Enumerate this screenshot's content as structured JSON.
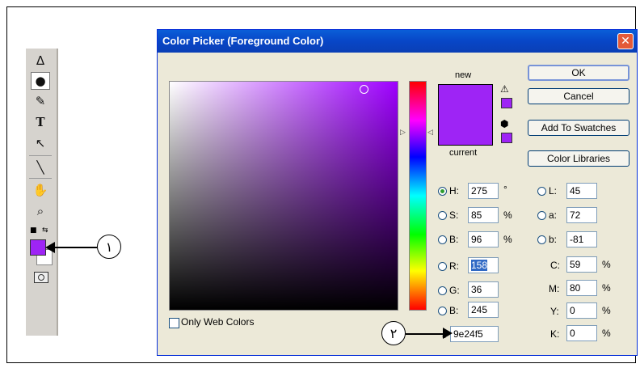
{
  "toolbox": {
    "tools": [
      {
        "icon": "Δ"
      },
      {
        "icon": "●"
      },
      {
        "icon": "✎"
      },
      {
        "icon": "T"
      },
      {
        "icon": "↖"
      },
      {
        "icon": "╲"
      },
      {
        "icon": "✋"
      },
      {
        "icon": "⌕"
      }
    ],
    "foreground_color": "#9e24f5",
    "background_color": "#ffffff"
  },
  "annotations": {
    "label1": "١",
    "label2": "٢"
  },
  "dialog": {
    "title": "Color Picker (Foreground Color)",
    "close": "✕",
    "new_label": "new",
    "current_label": "current",
    "color": "#9e24f5",
    "buttons": {
      "ok": "OK",
      "cancel": "Cancel",
      "add_to_swatches": "Add To Swatches",
      "color_libraries": "Color Libraries"
    },
    "hsb": [
      {
        "label": "H:",
        "value": "275",
        "unit": "°",
        "selected": true
      },
      {
        "label": "S:",
        "value": "85",
        "unit": "%"
      },
      {
        "label": "B:",
        "value": "96",
        "unit": "%"
      }
    ],
    "rgb": [
      {
        "label": "R:",
        "value": "158"
      },
      {
        "label": "G:",
        "value": "36"
      },
      {
        "label": "B:",
        "value": "245"
      }
    ],
    "lab": [
      {
        "label": "L:",
        "value": "45"
      },
      {
        "label": "a:",
        "value": "72"
      },
      {
        "label": "b:",
        "value": "-81"
      }
    ],
    "cmyk": [
      {
        "label": "C:",
        "value": "59",
        "unit": "%"
      },
      {
        "label": "M:",
        "value": "80",
        "unit": "%"
      },
      {
        "label": "Y:",
        "value": "0",
        "unit": "%"
      },
      {
        "label": "K:",
        "value": "0",
        "unit": "%"
      }
    ],
    "hex_label": "#",
    "hex_value": "9e24f5",
    "only_web_colors": "Only Web Colors"
  }
}
